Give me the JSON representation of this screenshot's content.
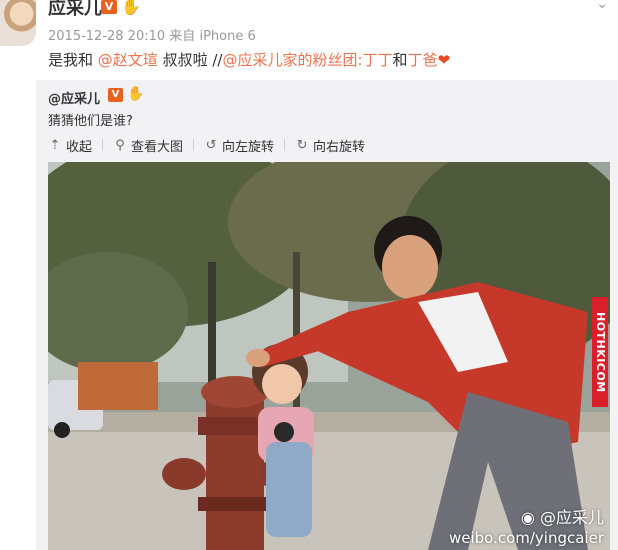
{
  "post": {
    "username": "应采儿",
    "verified_badge": "V",
    "member_badge": "heart-hand-badge",
    "timestamp": "2015-12-28 20:10",
    "source_prefix": "来自",
    "source_device": "iPhone 6",
    "text_lead": "是我和",
    "mention_1": "@赵文瑄",
    "text_middle": " 叔叔啦 //",
    "mention_2": "@应采儿家的粉丝团:丁丁",
    "text_and": "和",
    "mention_3": "丁爸",
    "heart": "❤"
  },
  "repost": {
    "username": "@应采儿",
    "verified_badge": "V",
    "text": "猜猜他们是谁?",
    "toolbar": {
      "collapse": "收起",
      "view_large": "查看大图",
      "rotate_left": "向左旋转",
      "rotate_right": "向右旋转"
    }
  },
  "photo": {
    "watermark_site": "HOTHKICOM",
    "watermark_user": "@应采儿",
    "watermark_url": "weibo.com/yingcaier"
  },
  "colors": {
    "link": "#eb7350",
    "badge": "#e8611f",
    "repost_bg": "#f2f2f5"
  }
}
